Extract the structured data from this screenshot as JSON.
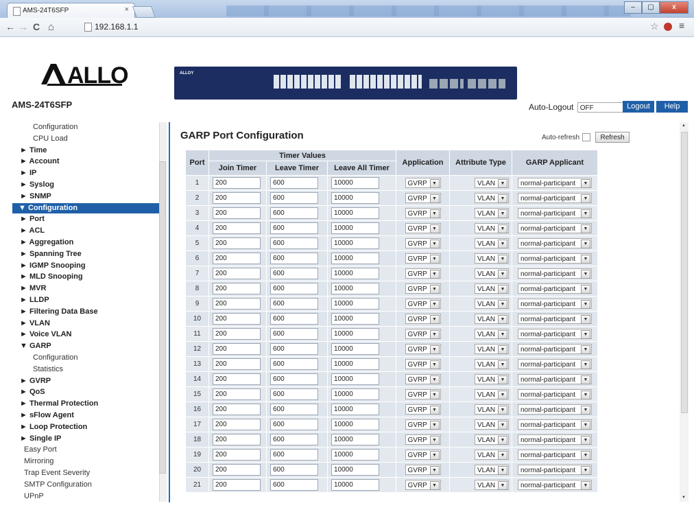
{
  "browser": {
    "tab_title": "AMS-24T6SFP",
    "tab_close": "×",
    "url": "192.168.1.1",
    "back_icon": "←",
    "forward_icon": "→",
    "reload_icon": "C",
    "home_icon": "⌂",
    "star_icon": "☆",
    "menu_icon": "≡",
    "win_min": "–",
    "win_max": "▢",
    "win_close": "x"
  },
  "header": {
    "logo_text": "ALLOY",
    "model": "AMS-24T6SFP",
    "switch_brand": "ALLOY",
    "auto_logout_label": "Auto-Logout",
    "auto_logout_value": "OFF",
    "logout_label": "Logout",
    "help_label": "Help",
    "accent_color": "#1f5fa8"
  },
  "sidebar": {
    "items": [
      {
        "label": "Configuration",
        "kind": "leaf",
        "indent": 48
      },
      {
        "label": "CPU Load",
        "kind": "leaf",
        "indent": 48
      },
      {
        "label": "► Time",
        "kind": "folder",
        "indent": 29
      },
      {
        "label": "► Account",
        "kind": "folder",
        "indent": 29
      },
      {
        "label": "► IP",
        "kind": "folder",
        "indent": 29
      },
      {
        "label": "► Syslog",
        "kind": "folder",
        "indent": 29
      },
      {
        "label": "► SNMP",
        "kind": "folder",
        "indent": 29
      },
      {
        "label": "▼ Configuration",
        "kind": "selected",
        "indent": 9
      },
      {
        "label": "► Port",
        "kind": "folder",
        "indent": 29
      },
      {
        "label": "► ACL",
        "kind": "folder",
        "indent": 29
      },
      {
        "label": "► Aggregation",
        "kind": "folder",
        "indent": 29
      },
      {
        "label": "► Spanning Tree",
        "kind": "folder",
        "indent": 29
      },
      {
        "label": "► IGMP Snooping",
        "kind": "folder",
        "indent": 29
      },
      {
        "label": "► MLD Snooping",
        "kind": "folder",
        "indent": 29
      },
      {
        "label": "► MVR",
        "kind": "folder",
        "indent": 29
      },
      {
        "label": "► LLDP",
        "kind": "folder",
        "indent": 29
      },
      {
        "label": "► Filtering Data Base",
        "kind": "folder",
        "indent": 29
      },
      {
        "label": "► VLAN",
        "kind": "folder",
        "indent": 29
      },
      {
        "label": "► Voice VLAN",
        "kind": "folder",
        "indent": 29
      },
      {
        "label": "▼ GARP",
        "kind": "folder",
        "indent": 29
      },
      {
        "label": "Configuration",
        "kind": "leaf",
        "indent": 48
      },
      {
        "label": "Statistics",
        "kind": "leaf",
        "indent": 48
      },
      {
        "label": "► GVRP",
        "kind": "folder",
        "indent": 29
      },
      {
        "label": "► QoS",
        "kind": "folder",
        "indent": 29
      },
      {
        "label": "► Thermal Protection",
        "kind": "folder",
        "indent": 29
      },
      {
        "label": "► sFlow Agent",
        "kind": "folder",
        "indent": 29
      },
      {
        "label": "► Loop Protection",
        "kind": "folder",
        "indent": 29
      },
      {
        "label": "► Single IP",
        "kind": "folder",
        "indent": 29
      },
      {
        "label": "Easy Port",
        "kind": "leaf",
        "indent": 35
      },
      {
        "label": "Mirroring",
        "kind": "leaf",
        "indent": 35
      },
      {
        "label": "Trap Event Severity",
        "kind": "leaf",
        "indent": 35
      },
      {
        "label": "SMTP Configuration",
        "kind": "leaf",
        "indent": 35
      },
      {
        "label": "UPnP",
        "kind": "leaf",
        "indent": 35
      }
    ]
  },
  "main": {
    "title": "GARP Port Configuration",
    "auto_refresh_label": "Auto-refresh",
    "refresh_label": "Refresh",
    "columns": {
      "port": "Port",
      "timer_group": "Timer Values",
      "join": "Join Timer",
      "leave": "Leave Timer",
      "leave_all": "Leave All Timer",
      "application": "Application",
      "attribute_type": "Attribute Type",
      "applicant": "GARP Applicant"
    },
    "rows": [
      {
        "port": "1",
        "join": "200",
        "leave": "600",
        "leave_all": "10000",
        "application": "GVRP",
        "attribute_type": "VLAN",
        "applicant": "normal-participant"
      },
      {
        "port": "2",
        "join": "200",
        "leave": "600",
        "leave_all": "10000",
        "application": "GVRP",
        "attribute_type": "VLAN",
        "applicant": "normal-participant"
      },
      {
        "port": "3",
        "join": "200",
        "leave": "600",
        "leave_all": "10000",
        "application": "GVRP",
        "attribute_type": "VLAN",
        "applicant": "normal-participant"
      },
      {
        "port": "4",
        "join": "200",
        "leave": "600",
        "leave_all": "10000",
        "application": "GVRP",
        "attribute_type": "VLAN",
        "applicant": "normal-participant"
      },
      {
        "port": "5",
        "join": "200",
        "leave": "600",
        "leave_all": "10000",
        "application": "GVRP",
        "attribute_type": "VLAN",
        "applicant": "normal-participant"
      },
      {
        "port": "6",
        "join": "200",
        "leave": "600",
        "leave_all": "10000",
        "application": "GVRP",
        "attribute_type": "VLAN",
        "applicant": "normal-participant"
      },
      {
        "port": "7",
        "join": "200",
        "leave": "600",
        "leave_all": "10000",
        "application": "GVRP",
        "attribute_type": "VLAN",
        "applicant": "normal-participant"
      },
      {
        "port": "8",
        "join": "200",
        "leave": "600",
        "leave_all": "10000",
        "application": "GVRP",
        "attribute_type": "VLAN",
        "applicant": "normal-participant"
      },
      {
        "port": "9",
        "join": "200",
        "leave": "600",
        "leave_all": "10000",
        "application": "GVRP",
        "attribute_type": "VLAN",
        "applicant": "normal-participant"
      },
      {
        "port": "10",
        "join": "200",
        "leave": "600",
        "leave_all": "10000",
        "application": "GVRP",
        "attribute_type": "VLAN",
        "applicant": "normal-participant"
      },
      {
        "port": "11",
        "join": "200",
        "leave": "600",
        "leave_all": "10000",
        "application": "GVRP",
        "attribute_type": "VLAN",
        "applicant": "normal-participant"
      },
      {
        "port": "12",
        "join": "200",
        "leave": "600",
        "leave_all": "10000",
        "application": "GVRP",
        "attribute_type": "VLAN",
        "applicant": "normal-participant"
      },
      {
        "port": "13",
        "join": "200",
        "leave": "600",
        "leave_all": "10000",
        "application": "GVRP",
        "attribute_type": "VLAN",
        "applicant": "normal-participant"
      },
      {
        "port": "14",
        "join": "200",
        "leave": "600",
        "leave_all": "10000",
        "application": "GVRP",
        "attribute_type": "VLAN",
        "applicant": "normal-participant"
      },
      {
        "port": "15",
        "join": "200",
        "leave": "600",
        "leave_all": "10000",
        "application": "GVRP",
        "attribute_type": "VLAN",
        "applicant": "normal-participant"
      },
      {
        "port": "16",
        "join": "200",
        "leave": "600",
        "leave_all": "10000",
        "application": "GVRP",
        "attribute_type": "VLAN",
        "applicant": "normal-participant"
      },
      {
        "port": "17",
        "join": "200",
        "leave": "600",
        "leave_all": "10000",
        "application": "GVRP",
        "attribute_type": "VLAN",
        "applicant": "normal-participant"
      },
      {
        "port": "18",
        "join": "200",
        "leave": "600",
        "leave_all": "10000",
        "application": "GVRP",
        "attribute_type": "VLAN",
        "applicant": "normal-participant"
      },
      {
        "port": "19",
        "join": "200",
        "leave": "600",
        "leave_all": "10000",
        "application": "GVRP",
        "attribute_type": "VLAN",
        "applicant": "normal-participant"
      },
      {
        "port": "20",
        "join": "200",
        "leave": "600",
        "leave_all": "10000",
        "application": "GVRP",
        "attribute_type": "VLAN",
        "applicant": "normal-participant"
      },
      {
        "port": "21",
        "join": "200",
        "leave": "600",
        "leave_all": "10000",
        "application": "GVRP",
        "attribute_type": "VLAN",
        "applicant": "normal-participant"
      }
    ]
  }
}
